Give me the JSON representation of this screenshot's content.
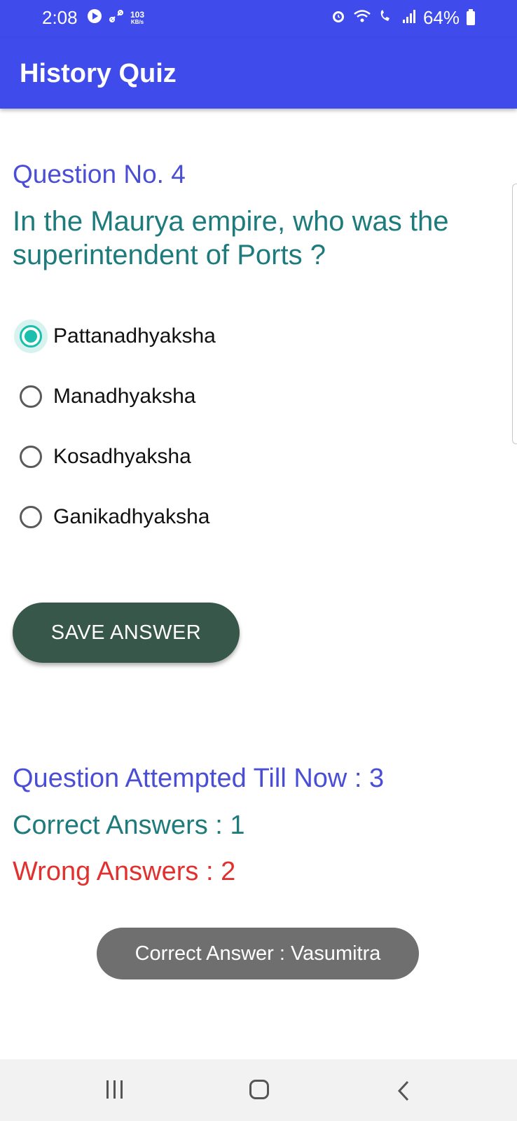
{
  "status_bar": {
    "time": "2:08",
    "speed_value": "103",
    "speed_unit": "KB/s",
    "battery": "64%"
  },
  "app_bar": {
    "title": "History Quiz"
  },
  "question": {
    "number_label": "Question No. 4",
    "text": "In the Maurya empire, who was the superintendent of Ports ?",
    "options": [
      {
        "label": "Pattanadhyaksha",
        "checked": true
      },
      {
        "label": "Manadhyaksha",
        "checked": false
      },
      {
        "label": "Kosadhyaksha",
        "checked": false
      },
      {
        "label": "Ganikadhyaksha",
        "checked": false
      }
    ]
  },
  "save_button": {
    "label": "SAVE ANSWER"
  },
  "stats": {
    "attempted": "Question Attempted Till Now : 3",
    "correct": "Correct Answers : 1",
    "wrong": "Wrong Answers : 2"
  },
  "toast": {
    "text": "Correct Answer : Vasumitra"
  },
  "colors": {
    "primary": "#3f4bea",
    "question_number": "#4a4ed6",
    "question_text": "#1e7b7c",
    "radio_accent": "#1bbfad",
    "button": "#37574a",
    "wrong": "#e0312f"
  },
  "icons": {
    "status_left": [
      "youtube-music-icon",
      "link-icon"
    ],
    "status_right": [
      "alarm-icon",
      "wifi-icon",
      "wifi-call-icon",
      "signal-icon",
      "battery-icon"
    ],
    "nav": [
      "recent-apps-icon",
      "home-icon",
      "back-icon"
    ]
  }
}
